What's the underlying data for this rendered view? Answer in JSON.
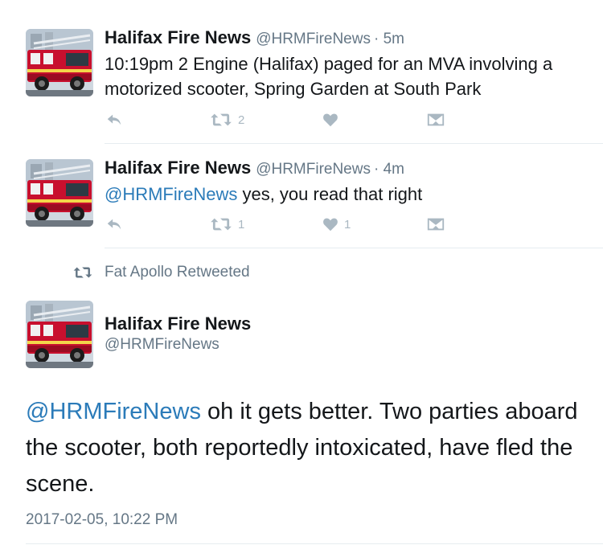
{
  "tweets": [
    {
      "name": "Halifax Fire News",
      "handle": "@HRMFireNews",
      "time": "· 5m",
      "text": "10:19pm 2 Engine (Halifax) paged for an MVA involving a motorized scooter, Spring Garden at South Park",
      "retweets": "2",
      "likes": ""
    },
    {
      "name": "Halifax Fire News",
      "handle": "@HRMFireNews",
      "time": "· 4m",
      "mention": "@HRMFireNews",
      "text": " yes, you read that right",
      "retweets": "1",
      "likes": "1"
    }
  ],
  "retweet_notice": "Fat Apollo Retweeted",
  "focus_tweet": {
    "name": "Halifax Fire News",
    "handle": "@HRMFireNews",
    "mention": "@HRMFireNews",
    "text": " oh it gets better. Two parties aboard the scooter, both reportedly intoxicated, have fled the scene.",
    "timestamp": "2017-02-05, 10:22 PM"
  },
  "icons": {
    "reply": "reply-arrow-icon",
    "retweet": "retweet-icon",
    "like": "heart-icon",
    "dm": "envelope-icon"
  },
  "colors": {
    "mention": "#2b7bb9",
    "meta": "#657786",
    "icon": "#aab8c2",
    "divider": "#e6ecf0"
  }
}
